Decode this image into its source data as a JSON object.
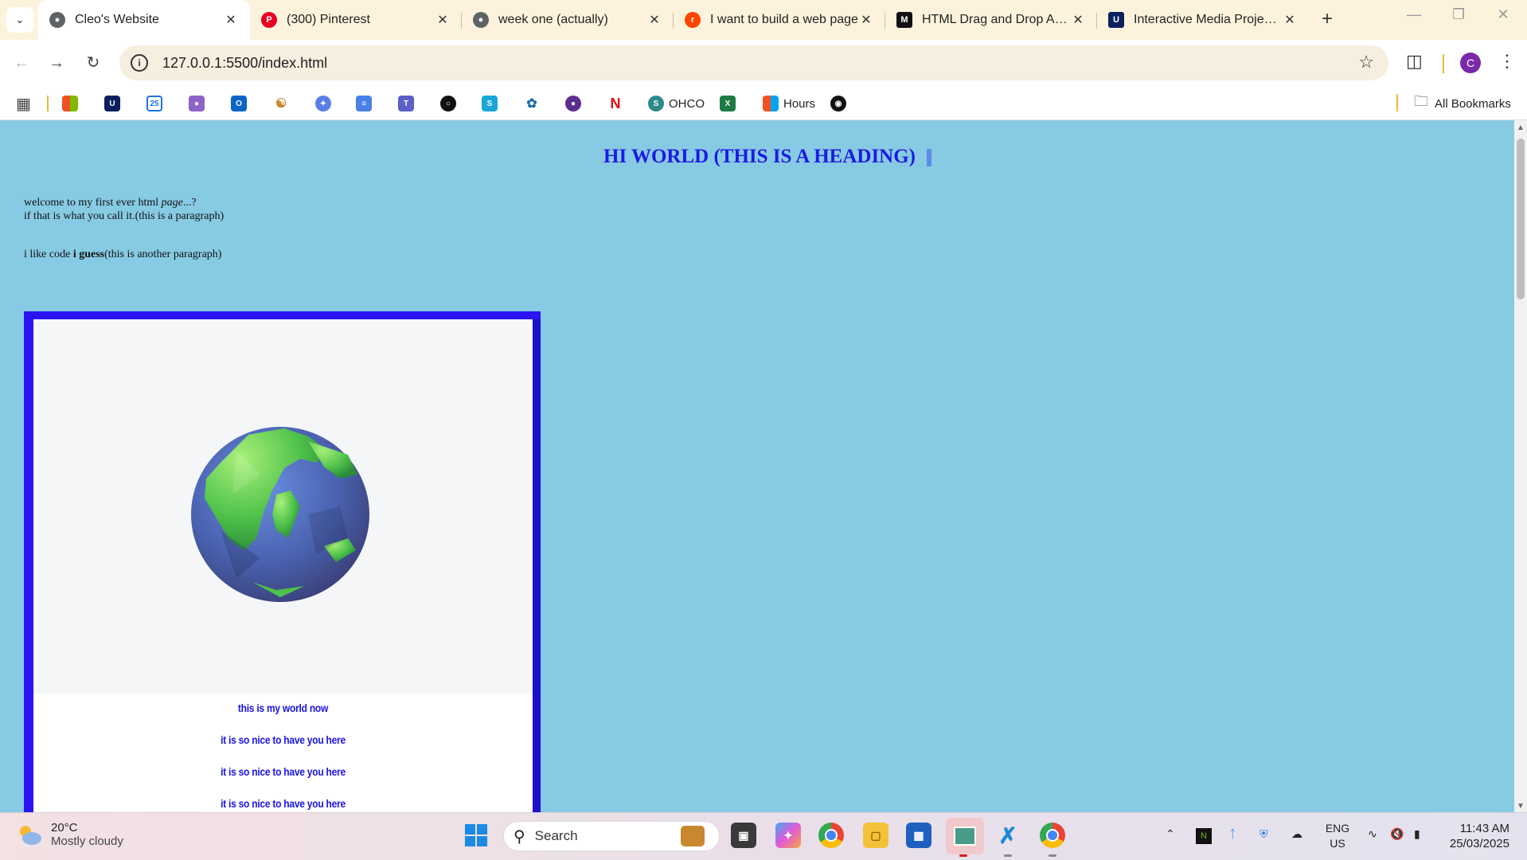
{
  "browser": {
    "tabs": [
      {
        "title": "Cleo's Website",
        "active": true,
        "favicon": "globe-icon",
        "favicon_color": "#5f6368"
      },
      {
        "title": "(300) Pinterest",
        "active": false,
        "favicon": "pinterest-icon",
        "favicon_color": "#e60023"
      },
      {
        "title": "week one (actually)",
        "active": false,
        "favicon": "globe-icon",
        "favicon_color": "#5f6368"
      },
      {
        "title": "I want to build a web page",
        "active": false,
        "favicon": "reddit-icon",
        "favicon_color": "#ff4500"
      },
      {
        "title": "HTML Drag and Drop API -",
        "active": false,
        "favicon": "mdn-icon",
        "favicon_color": "#111111"
      },
      {
        "title": "Interactive Media Project 2",
        "active": false,
        "favicon": "uts-icon",
        "favicon_color": "#0b1f5c"
      }
    ],
    "url": "127.0.0.1:5500/index.html",
    "profile_initial": "C",
    "bookmarks": {
      "ohco_label": "OHCO",
      "hours_label": "Hours",
      "all_bookmarks_label": "All Bookmarks"
    }
  },
  "page": {
    "heading": "HI WORLD (THIS IS A HEADING)",
    "paragraph1": {
      "line1_text": "welcome to my first ever html ",
      "line1_em": "page",
      "line1_tail": "...?",
      "line2": "if that is what you call it.(this is a paragraph)"
    },
    "paragraph2": {
      "text": "i like code ",
      "bold": "i guess",
      "tail": "(this is another paragraph)"
    },
    "world_captions": [
      "this is my world now",
      "it is so nice to have you here",
      "it is so nice to have you here",
      "it is so nice to have you here"
    ],
    "colors": {
      "background": "#87cae3",
      "heading": "#1a1ae6",
      "box_border": "#2a14f2"
    }
  },
  "taskbar": {
    "weather_temp": "20°C",
    "weather_desc": "Mostly cloudy",
    "search_label": "Search",
    "lang_line1": "ENG",
    "lang_line2": "US",
    "time": "11:43 AM",
    "date": "25/03/2025"
  }
}
